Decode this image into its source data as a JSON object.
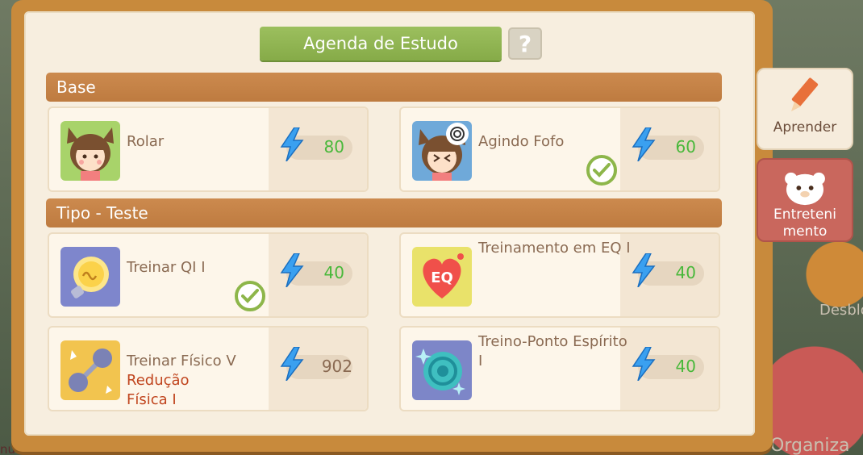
{
  "title": "Agenda de Estudo",
  "help_label": "?",
  "sections": [
    {
      "label": "Base"
    },
    {
      "label": "Tipo - Teste"
    }
  ],
  "cards": [
    {
      "name": "Rolar",
      "cost": "80",
      "icon": "girl-cat-icon",
      "completed": false
    },
    {
      "name": "Agindo Fofo",
      "cost": "60",
      "icon": "girl-cat-dizzy-icon",
      "completed": true
    },
    {
      "name": "Treinar QI I",
      "cost": "40",
      "icon": "lightbulb-icon",
      "completed": true
    },
    {
      "name": "Treinamento em EQ I",
      "cost": "40",
      "icon": "eq-heart-icon",
      "completed": false
    },
    {
      "name": "Treinar Físico V",
      "sub": "Redução Física I",
      "cost": "902",
      "icon": "dumbbell-icon",
      "completed": false
    },
    {
      "name": "Treino-Ponto Espírito I",
      "cost": "40",
      "icon": "spirit-galaxy-icon",
      "completed": false
    }
  ],
  "side_tabs": {
    "learn_label": "Aprender",
    "ent_label_1": "Entreteni",
    "ent_label_2": "mento"
  },
  "edge_labels": {
    "right_mid": "Desblo",
    "right_bottom": "Organiza",
    "left_bottom": "nual"
  },
  "colors": {
    "accent_green": "#86ab48",
    "cost_green": "#48b83a",
    "section_orange": "#c48244",
    "sub_red": "#c0441d"
  }
}
